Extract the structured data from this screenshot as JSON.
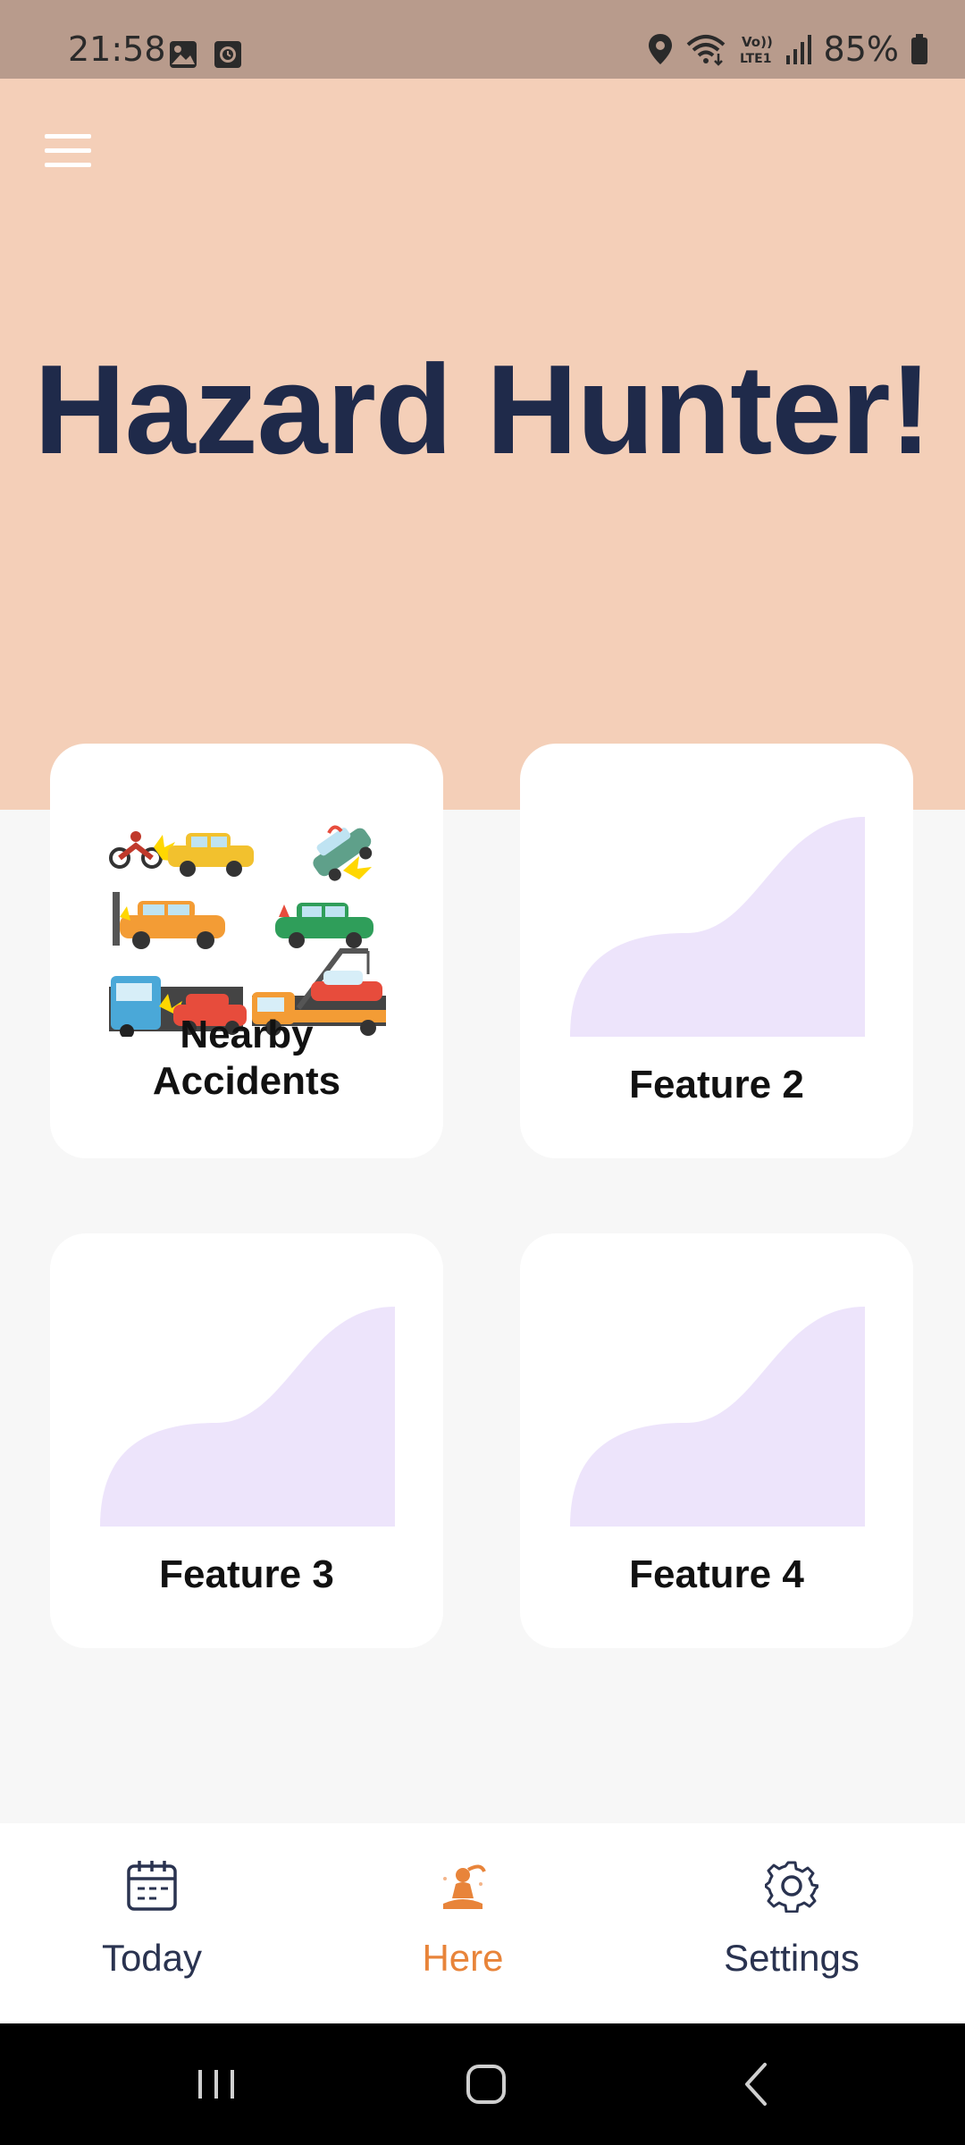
{
  "status_bar": {
    "time": "21:58",
    "battery": "85%",
    "icons": [
      "gallery-icon",
      "clock-icon",
      "location-icon",
      "wifi-icon",
      "volte-icon",
      "signal-icon",
      "battery-icon"
    ],
    "volte_text": "Vo)) LTE1"
  },
  "header": {
    "title": "Hazard Hunter!",
    "background_color": "#f4cfb8",
    "title_color": "#1f2a4a"
  },
  "features": [
    {
      "label": "Nearby Accidents",
      "line1": "Nearby",
      "line2": "Accidents",
      "image": "accidents-illustration"
    },
    {
      "label": "Feature 2",
      "image": "placeholder-shape"
    },
    {
      "label": "Feature 3",
      "image": "placeholder-shape"
    },
    {
      "label": "Feature 4",
      "image": "placeholder-shape"
    }
  ],
  "bottom_nav": {
    "items": [
      {
        "label": "Today",
        "icon": "calendar-icon",
        "active": false
      },
      {
        "label": "Here",
        "icon": "meditation-icon",
        "active": true
      },
      {
        "label": "Settings",
        "icon": "gear-icon",
        "active": false
      }
    ],
    "active_color": "#e8843a",
    "inactive_color": "#2a3350"
  },
  "system_nav": {
    "buttons": [
      "recents-icon",
      "home-icon",
      "back-icon"
    ]
  }
}
